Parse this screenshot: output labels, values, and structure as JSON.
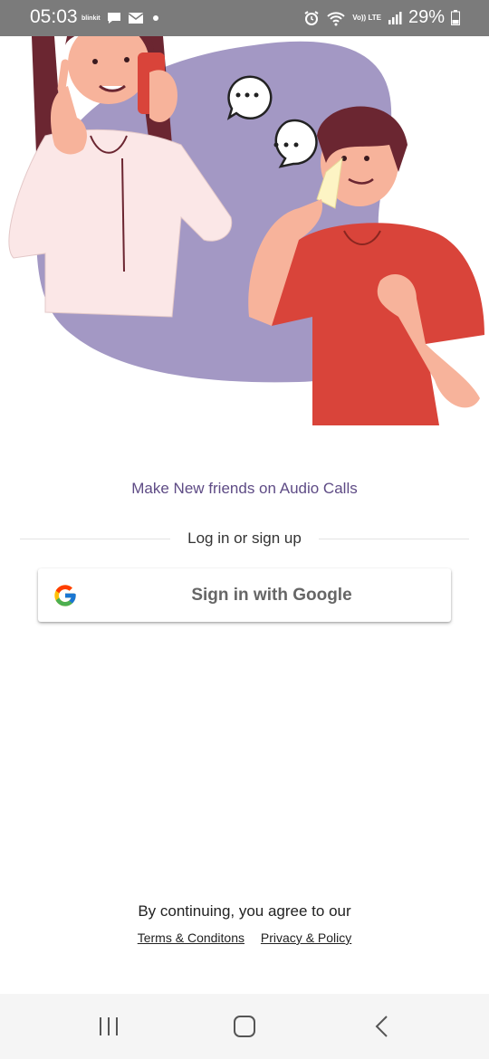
{
  "status_bar": {
    "time": "05:03",
    "app_badge": "blinkit",
    "battery": "29%",
    "network": "Vo)) LTE"
  },
  "main": {
    "tagline": "Make New friends on Audio Calls",
    "divider_label": "Log in or sign up",
    "google_button_label": "Sign in with Google"
  },
  "footer": {
    "agree_text": "By continuing, you agree to our",
    "terms_link": "Terms & Conditons",
    "privacy_link": "Privacy & Policy"
  },
  "icons": {
    "status_left": [
      "blinkit-icon",
      "chat-icon",
      "mail-icon",
      "dot-icon"
    ],
    "status_right": [
      "alarm-icon",
      "wifi-icon",
      "signal-icon",
      "battery-icon"
    ],
    "google": "google-g-icon",
    "nav": [
      "recents-icon",
      "home-icon",
      "back-icon"
    ]
  },
  "colors": {
    "accent": "#5e4b85",
    "blob": "#a398c4",
    "man_shirt": "#d9443a",
    "hair": "#6b2631",
    "status_bar": "#7b7b7b"
  }
}
